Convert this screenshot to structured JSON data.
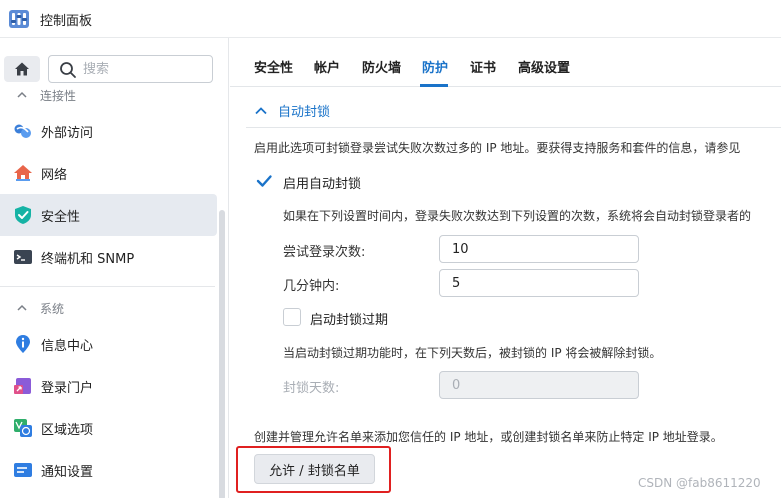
{
  "window": {
    "title": "控制面板",
    "app_icon": "control-panel-icon"
  },
  "sidebar": {
    "search": {
      "placeholder": "搜索",
      "value": ""
    },
    "group_connectivity": {
      "label": "连接性"
    },
    "items": [
      {
        "label": "外部访问",
        "icon": "external-access-icon"
      },
      {
        "label": "网络",
        "icon": "network-house-icon"
      },
      {
        "label": "安全性",
        "icon": "shield-check-icon",
        "active": true
      },
      {
        "label": "终端机和 SNMP",
        "icon": "terminal-icon"
      }
    ],
    "group_system": {
      "label": "系统"
    },
    "system_items": [
      {
        "label": "信息中心",
        "icon": "info-icon"
      },
      {
        "label": "登录门户",
        "icon": "login-portal-icon"
      },
      {
        "label": "区域选项",
        "icon": "region-icon"
      },
      {
        "label": "通知设置",
        "icon": "notification-icon"
      }
    ]
  },
  "tabs": [
    {
      "label": "安全性"
    },
    {
      "label": "帐户"
    },
    {
      "label": "防火墙"
    },
    {
      "label": "防护",
      "active": true
    },
    {
      "label": "证书"
    },
    {
      "label": "高级设置"
    }
  ],
  "auto_block": {
    "section_title": "自动封锁",
    "description": "启用此选项可封锁登录尝试失败次数过多的 IP 地址。要获得支持服务和套件的信息，请参见",
    "enable_label": "启用自动封锁",
    "enable_checked": true,
    "sub_description": "如果在下列设置时间内，登录失败次数达到下列设置的次数，系统将会自动封锁登录者的",
    "attempts_label": "尝试登录次数:",
    "attempts_value": "10",
    "minutes_label": "几分钟内:",
    "minutes_value": "5",
    "expire_label": "启动封锁过期",
    "expire_checked": false,
    "expire_description": "当启动封锁过期功能时，在下列天数后，被封锁的 IP 将会被解除封锁。",
    "days_label": "封锁天数:",
    "days_value": "0",
    "allowlist_description": "创建并管理允许名单来添加您信任的 IP 地址，或创建封锁名单来防止特定 IP 地址登录。",
    "allow_block_button": "允许 / 封锁名单"
  },
  "watermark": "CSDN @fab8611220",
  "colors": {
    "accent": "#1a73c9",
    "highlight": "#e02020",
    "active_bg": "#e6eaf0"
  }
}
